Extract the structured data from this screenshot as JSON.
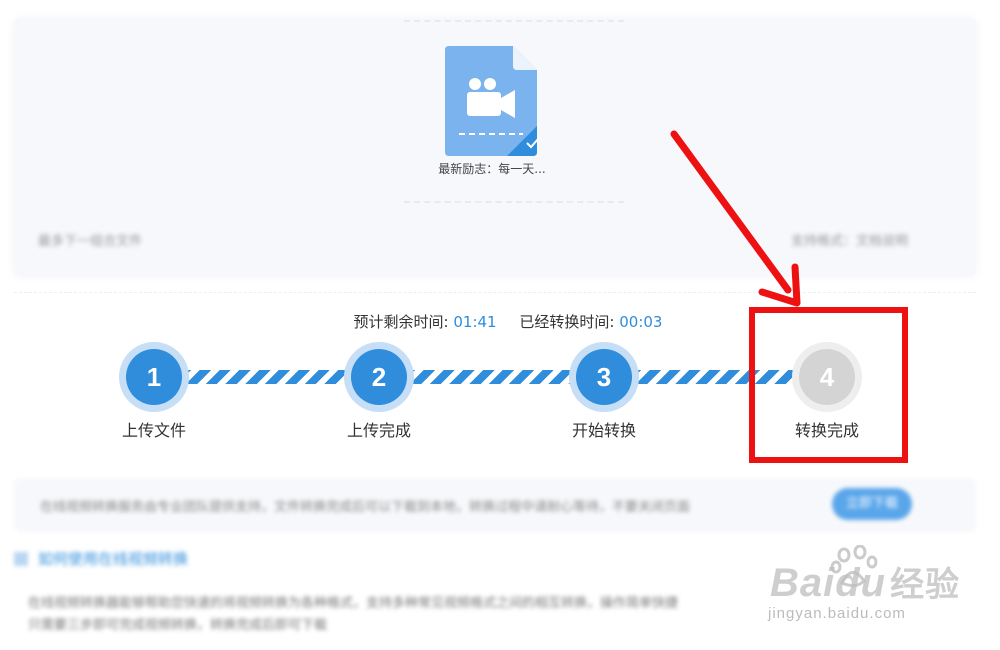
{
  "file": {
    "name": "最新励志：每一天...",
    "icon": "video-file-icon",
    "check_icon": "checkmark-icon"
  },
  "upload_card": {
    "left_text": "最多下一组合文件",
    "right_text": "支持格式：文档说明"
  },
  "progress": {
    "remaining_label": "预计剩余时间:",
    "remaining_value": "01:41",
    "elapsed_label": "已经转换时间:",
    "elapsed_value": "00:03",
    "steps": [
      {
        "number": "1",
        "label": "上传文件",
        "state": "active"
      },
      {
        "number": "2",
        "label": "上传完成",
        "state": "active"
      },
      {
        "number": "3",
        "label": "开始转换",
        "state": "active"
      },
      {
        "number": "4",
        "label": "转换完成",
        "state": "pending"
      }
    ]
  },
  "info_bar": {
    "text": "在线视频转换服务由专业团队提供支持，文件转换完成后可以下载到本地，转换过程中请耐心等待，不要关闭页面",
    "button": "立即下载"
  },
  "help": {
    "title": "如何使用在线视频转换",
    "line1": "在线视频转换器能够帮助您快速的将视频转换为各种格式，支持多种常见视频格式之间的相互转换，操作简单快捷",
    "line2": "只需要三步即可完成视频转换，转换完成后即可下载"
  },
  "watermark": {
    "brand": "Baidu",
    "brand_cn": "经验",
    "url": "jingyan.baidu.com"
  },
  "colors": {
    "accent": "#2f8ddb",
    "annotation": "#ee1111",
    "pending": "#d4d4d4"
  }
}
